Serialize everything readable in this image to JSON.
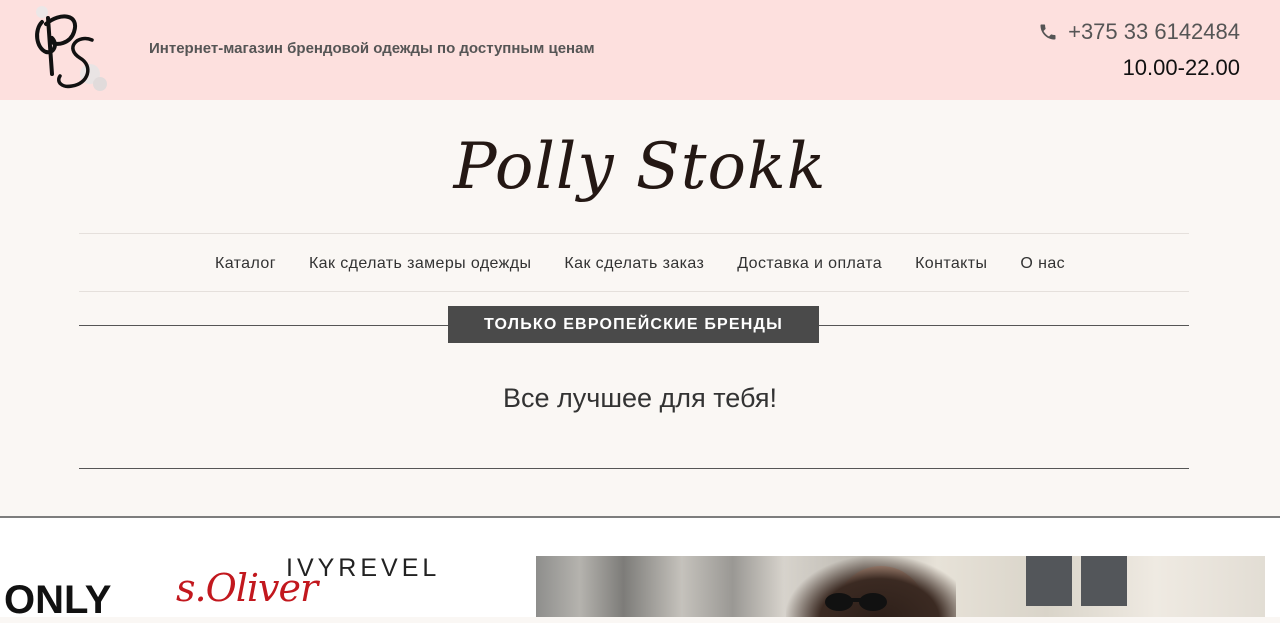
{
  "header": {
    "tagline": "Интернет-магазин брендовой одежды по доступным ценам",
    "phone": "+375 33 6142484",
    "hours": "10.00-22.00",
    "phone_icon": "phone-icon",
    "logo_text": "PS"
  },
  "brand": {
    "name": "Polly Stokk"
  },
  "nav": {
    "items": [
      {
        "label": "Каталог"
      },
      {
        "label": "Как сделать замеры одежды"
      },
      {
        "label": "Как сделать заказ"
      },
      {
        "label": "Доставка и оплата"
      },
      {
        "label": "Контакты"
      },
      {
        "label": "О нас"
      }
    ]
  },
  "banner": {
    "title": "ТОЛЬКО ЕВРОПЕЙСКИЕ БРЕНДЫ",
    "slogan": "Все лучшее для тебя!"
  },
  "brands": {
    "only": "ONLY",
    "soliver": "s.Oliver",
    "ivyrevel": "IVYREVEL"
  },
  "colors": {
    "topbar_bg": "#fde0de",
    "page_bg": "#faf7f4",
    "banner_bg": "#4a4a4a",
    "soliver_red": "#c2181e"
  }
}
